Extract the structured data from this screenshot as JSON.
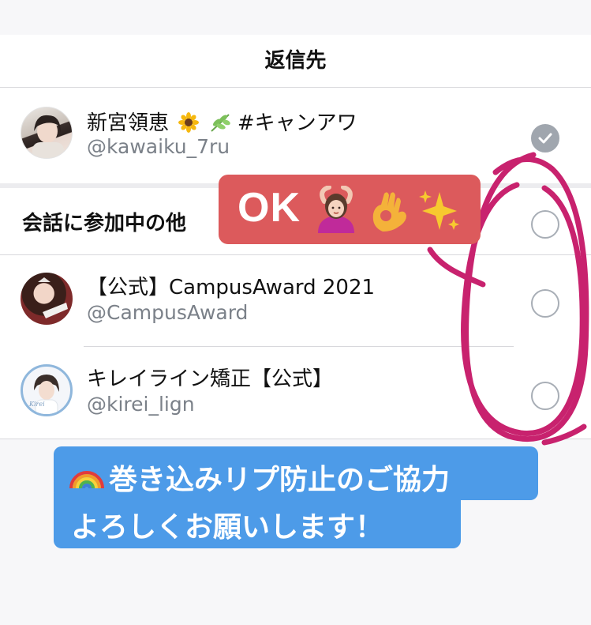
{
  "header": {
    "title": "返信先"
  },
  "primary_user": {
    "name": "新宮領恵",
    "name_tail": "#キャンアワ",
    "handle": "@kawaiku_7ru",
    "selected": true
  },
  "section": {
    "label": "会話に参加中の他"
  },
  "others": [
    {
      "name": "【公式】CampusAward 2021",
      "handle": "@CampusAward",
      "selected": false
    },
    {
      "name": "キレイライン矯正【公式】",
      "handle": "@kirei_lign",
      "selected": false
    }
  ],
  "annotation_ok": {
    "text": "OK"
  },
  "annotation_note": {
    "line1": "巻き込みリプ防止のご協力",
    "line2": "よろしくお願いします！"
  },
  "icons": [
    "sunflower-icon",
    "herb-icon",
    "woman-gesturing-ok-icon",
    "ok-hand-icon",
    "sparkles-icon",
    "rainbow-icon",
    "checkmark-icon"
  ],
  "colors": {
    "accent_red": "#dc5a5c",
    "accent_blue": "#4d9be8",
    "scribble_magenta": "#c8226e",
    "radio_gray": "#a0a6ae"
  }
}
